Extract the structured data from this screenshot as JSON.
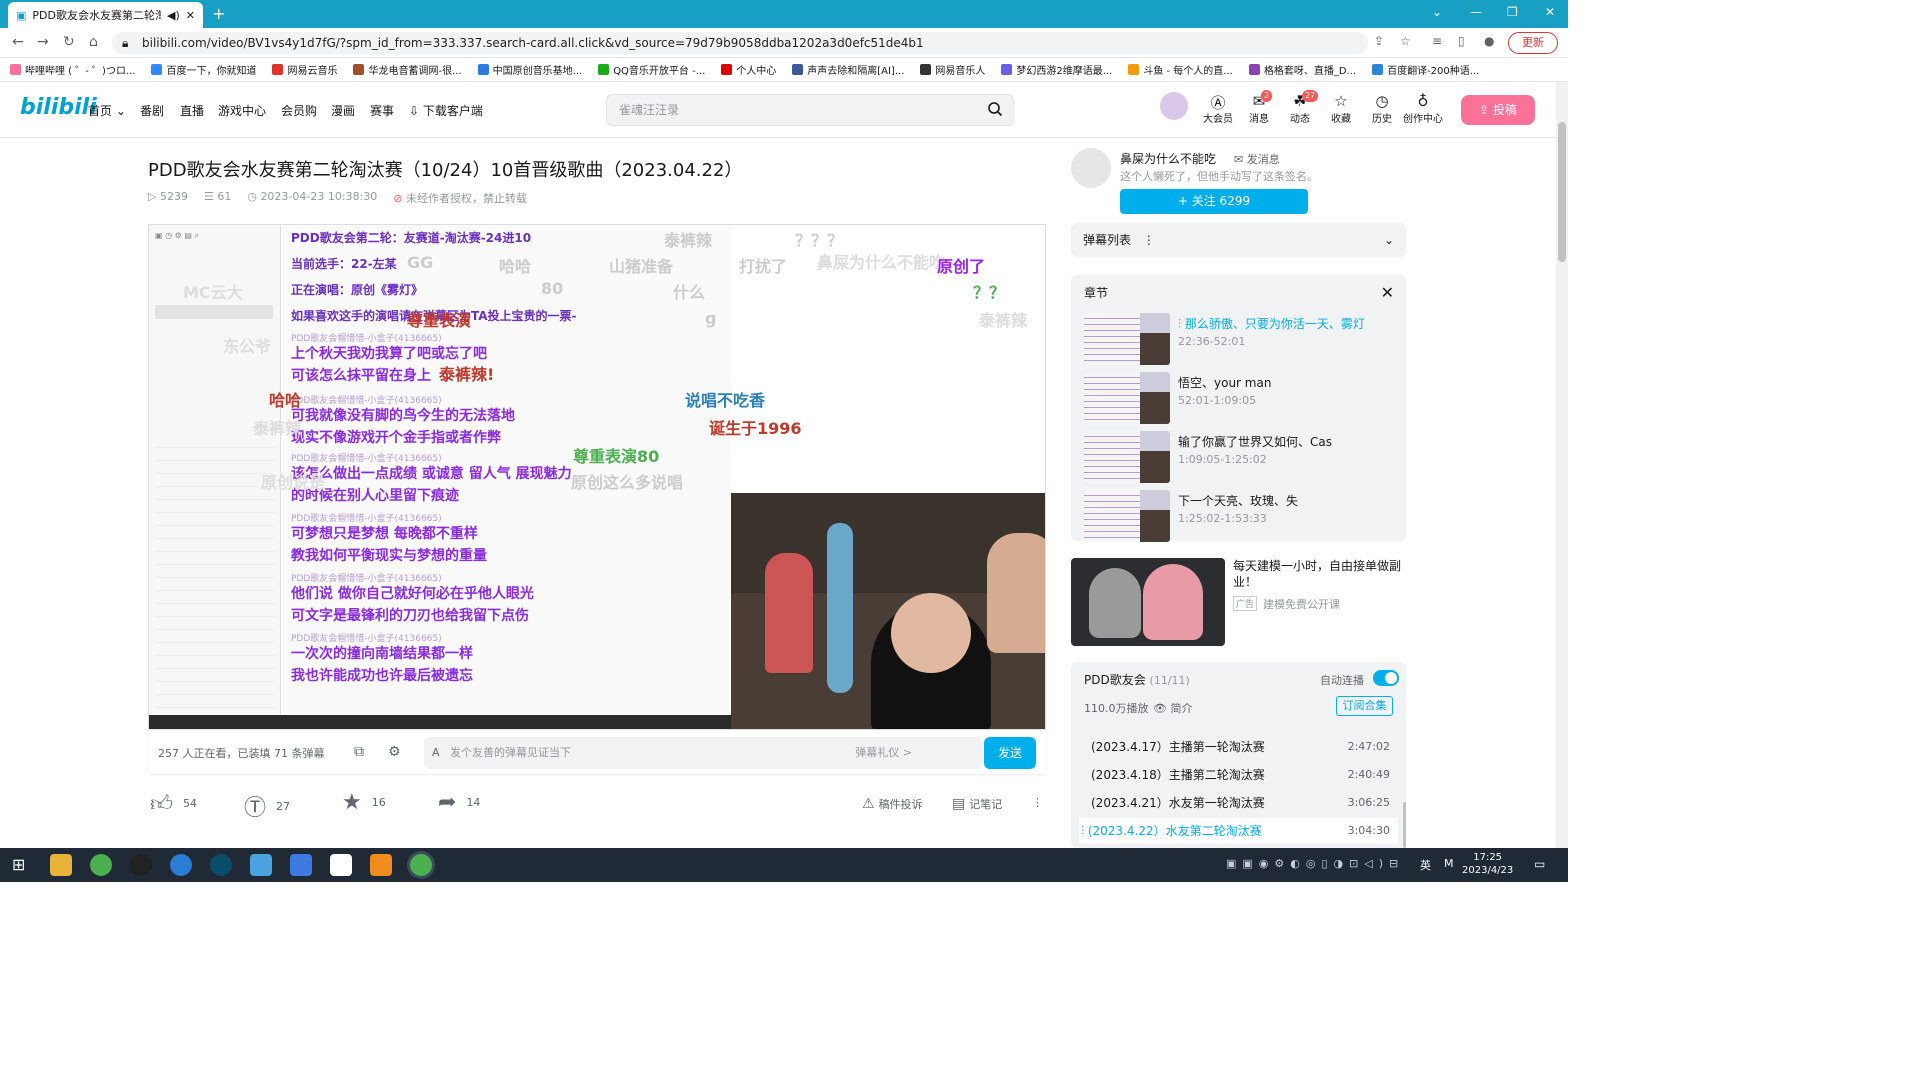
{
  "browser": {
    "tab_title": "PDD歌友会水友赛第二轮淘",
    "url": "bilibili.com/video/BV1vs4y1d7fG/?spm_id_from=333.337.search-card.all.click&vd_source=79d79b9058ddba1202a3d0efc51de4b1",
    "update_label": "更新",
    "bookmarks": [
      "哔哩哔哩 ( ゜- ゜)つロ...",
      "百度一下，你就知道",
      "网易云音乐",
      "华龙电音蓄调网-很...",
      "中国原创音乐基地...",
      "QQ音乐开放平台 -...",
      "个人中心",
      "声声去除和隔离[AI]...",
      "网易音乐人",
      "梦幻西游2维摩语最...",
      "斗鱼 - 每个人的直...",
      "格格套呀、直播_D...",
      "百度翻译-200种语..."
    ]
  },
  "header": {
    "logo": "bilibili",
    "nav": [
      "首页",
      "番剧",
      "直播",
      "游戏中心",
      "会员购",
      "漫画",
      "赛事",
      "下载客户端"
    ],
    "search_placeholder": "雀魂汪汪录",
    "icons": [
      {
        "label": "大会员",
        "badge": ""
      },
      {
        "label": "消息",
        "badge": "2"
      },
      {
        "label": "动态",
        "badge": "27"
      },
      {
        "label": "收藏",
        "badge": ""
      },
      {
        "label": "历史",
        "badge": ""
      },
      {
        "label": "创作中心",
        "badge": ""
      }
    ],
    "upload_label": "投稿"
  },
  "video": {
    "title": "PDD歌友会水友赛第二轮淘汰赛（10/24）10首晋级歌曲（2023.04.22）",
    "views": "5239",
    "danmaku_count": "61",
    "pubdate": "2023-04-23 10:38:30",
    "copyright": "未经作者授权，禁止转载"
  },
  "player": {
    "lyric_header": [
      "PDD歌友会第二轮：友赛道-淘汰赛-24进10",
      "当前选手：22-左某",
      "正在演唱：原创《雾灯》",
      "如果喜欢这手的演唱请在弹幕区为TA投上宝贵的一票-"
    ],
    "lyrics": [
      "上个秋天我劝我算了吧或忘了吧",
      "可该怎么抹平留在身上",
      "可我就像没有脚的鸟今生的无法落地",
      "现实不像游戏开个金手指或者作弊",
      "该怎么做出一点成绩 或诚意  留人气  展现魅力",
      "的时候在别人心里留下痕迹",
      "可梦想只是梦想  每晚都不重样",
      "教我如何平衡现实与梦想的重量",
      "他们说 做你自己就好何必在乎他人眼光",
      "可文字是最锋利的刀刃也给我留下点伤",
      "一次次的撞向南墙结果都一样",
      "我也许能成功也许最后被遗忘"
    ],
    "lyric_small": "PDD歌友会帽惜惜-小盒子(4136665)",
    "danmaku": [
      "泰裤辣",
      "哈哈",
      "山猪准备",
      "打扰了",
      "鼻屎为什么不能吃",
      "原创了",
      "MC云大",
      "东公爷",
      "什么",
      "泰裤辣",
      "尊重表演",
      "泰裤辣!",
      "哈哈",
      "说唱不吃香",
      "诞生于1996",
      "泰裤辣",
      "尊重表演80",
      "原创这么多说唱",
      "原创说是",
      "？？？",
      "？？",
      "GG",
      "80",
      "g"
    ]
  },
  "danmaku_bar": {
    "watching": "257 人正在看，已装填 71 条弹幕",
    "placeholder": "发个友善的弹幕见证当下",
    "etiquette": "弹幕礼仪 >",
    "send": "发送"
  },
  "actions": {
    "like": "54",
    "coin": "27",
    "fav": "16",
    "share": "14",
    "report": "稿件投诉",
    "note": "记笔记"
  },
  "up": {
    "name": "鼻屎为什么不能吃",
    "message": "发消息",
    "sign": "这个人懒死了，但他手动写了这条签名。",
    "follow": "+ 关注 6299"
  },
  "sidebar": {
    "danmaku_list": "弹幕列表",
    "chapters_title": "章节",
    "chapters": [
      {
        "title": "那么骄傲、只要为你活一天、雾灯",
        "time": "22:36-52:01",
        "active": true
      },
      {
        "title": "悟空、your man",
        "time": "52:01-1:09:05",
        "active": false
      },
      {
        "title": "输了你赢了世界又如何、Cas",
        "time": "1:09:05-1:25:02",
        "active": false
      },
      {
        "title": "下一个天亮、玫瑰、失",
        "time": "1:25:02-1:53:33",
        "active": false
      }
    ],
    "ad": {
      "title": "每天建模一小时，自由接单做副业！",
      "tag": "广告",
      "sub": "建模免费公开课"
    },
    "collection": {
      "title": "PDD歌友会",
      "count": "(11/11)",
      "autoplay": "自动连播",
      "plays": "110.0万播放",
      "intro": "简介",
      "subscribe": "订阅合集",
      "episodes": [
        {
          "title": "(2023.4.17）主播第一轮淘汰赛",
          "dur": "2:47:02",
          "active": false
        },
        {
          "title": "(2023.4.18）主播第二轮淘汰赛",
          "dur": "2:40:49",
          "active": false
        },
        {
          "title": "(2023.4.21）水友第一轮淘汰赛",
          "dur": "3:06:25",
          "active": false
        },
        {
          "title": "(2023.4.22）水友第二轮淘汰赛",
          "dur": "3:04:30",
          "active": true
        }
      ]
    }
  },
  "taskbar": {
    "time": "17:25",
    "date": "2023/4/23",
    "ime": "英"
  },
  "colors": {
    "accent": "#00aeec",
    "pink": "#fb7299",
    "lyric": "#8a2be2",
    "chrome": "#18a0c4"
  }
}
